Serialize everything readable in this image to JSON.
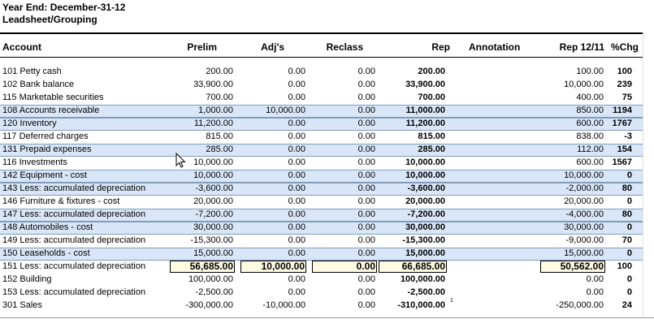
{
  "header": {
    "year_end": "Year End: December-31-12",
    "subtitle": "Leadsheet/Grouping"
  },
  "columns": {
    "account": "Account",
    "prelim": "Prelim",
    "adjs": "Adj's",
    "reclass": "Reclass",
    "rep": "Rep",
    "annotation": "Annotation",
    "rep_prior": "Rep 12/11",
    "pct_chg": "%Chg"
  },
  "rows": [
    {
      "account": "101 Petty cash",
      "prelim": "200.00",
      "adjs": "0.00",
      "reclass": "0.00",
      "rep": "200.00",
      "rep_prior": "100.00",
      "pct": "100",
      "band": false
    },
    {
      "account": "102 Bank balance",
      "prelim": "33,900.00",
      "adjs": "0.00",
      "reclass": "0.00",
      "rep": "33,900.00",
      "rep_prior": "10,000.00",
      "pct": "239",
      "band": false
    },
    {
      "account": "115 Marketable securities",
      "prelim": "700.00",
      "adjs": "0.00",
      "reclass": "0.00",
      "rep": "700.00",
      "rep_prior": "400.00",
      "pct": "75",
      "band": false
    },
    {
      "account": "108 Accounts receivable",
      "prelim": "1,000.00",
      "adjs": "10,000.00",
      "reclass": "0.00",
      "rep": "11,000.00",
      "rep_prior": "850.00",
      "pct": "1194",
      "band": true
    },
    {
      "account": "120 Inventory",
      "prelim": "11,200.00",
      "adjs": "0.00",
      "reclass": "0.00",
      "rep": "11,200.00",
      "rep_prior": "600.00",
      "pct": "1767",
      "band": true
    },
    {
      "account": "117 Deferred charges",
      "prelim": "815.00",
      "adjs": "0.00",
      "reclass": "0.00",
      "rep": "815.00",
      "rep_prior": "838.00",
      "pct": "-3",
      "band": false
    },
    {
      "account": "131 Prepaid expenses",
      "prelim": "285.00",
      "adjs": "0.00",
      "reclass": "0.00",
      "rep": "285.00",
      "rep_prior": "112.00",
      "pct": "154",
      "band": true
    },
    {
      "account": "116 Investments",
      "prelim": "10,000.00",
      "adjs": "0.00",
      "reclass": "0.00",
      "rep": "10,000.00",
      "rep_prior": "600.00",
      "pct": "1567",
      "band": false
    },
    {
      "account": "142 Equipment - cost",
      "prelim": "10,000.00",
      "adjs": "0.00",
      "reclass": "0.00",
      "rep": "10,000.00",
      "rep_prior": "10,000.00",
      "pct": "0",
      "band": true
    },
    {
      "account": "143 Less: accumulated depreciation",
      "prelim": "-3,600.00",
      "adjs": "0.00",
      "reclass": "0.00",
      "rep": "-3,600.00",
      "rep_prior": "-2,000.00",
      "pct": "80",
      "band": true
    },
    {
      "account": "146 Furniture & fixtures - cost",
      "prelim": "20,000.00",
      "adjs": "0.00",
      "reclass": "0.00",
      "rep": "20,000.00",
      "rep_prior": "20,000.00",
      "pct": "0",
      "band": false
    },
    {
      "account": "147 Less: accumulated depreciation",
      "prelim": "-7,200.00",
      "adjs": "0.00",
      "reclass": "0.00",
      "rep": "-7,200.00",
      "rep_prior": "-4,000.00",
      "pct": "80",
      "band": true
    },
    {
      "account": "148 Automobiles - cost",
      "prelim": "30,000.00",
      "adjs": "0.00",
      "reclass": "0.00",
      "rep": "30,000.00",
      "rep_prior": "30,000.00",
      "pct": "0",
      "band": true
    },
    {
      "account": "149 Less: accumulated depreciation",
      "prelim": "-15,300.00",
      "adjs": "0.00",
      "reclass": "0.00",
      "rep": "-15,300.00",
      "rep_prior": "-9,000.00",
      "pct": "70",
      "band": false
    },
    {
      "account": "150 Leaseholds - cost",
      "prelim": "15,000.00",
      "adjs": "0.00",
      "reclass": "0.00",
      "rep": "15,000.00",
      "rep_prior": "15,000.00",
      "pct": "0",
      "band": true
    },
    {
      "account": "151 Less: accumulated depreciation",
      "prelim": "56,685.00",
      "adjs": "10,000.00",
      "reclass": "0.00",
      "rep": "66,685.00",
      "rep_prior": "50,562.00",
      "pct": "100",
      "band": false,
      "total": true
    },
    {
      "account": "152 Building",
      "prelim": "100,000.00",
      "adjs": "0.00",
      "reclass": "0.00",
      "rep": "100,000.00",
      "rep_prior": "0.00",
      "pct": "0",
      "band": false
    },
    {
      "account": "153 Less:  accumulated depreciation",
      "prelim": "-2,500.00",
      "adjs": "0.00",
      "reclass": "0.00",
      "rep": "-2,500.00",
      "rep_prior": "0.00",
      "pct": "0",
      "band": false
    },
    {
      "account": "301 Sales",
      "prelim": "-300,000.00",
      "adjs": "-10,000.00",
      "reclass": "0.00",
      "rep": "-310,000.00",
      "rep_prior": "-250,000.00",
      "pct": "24",
      "band": false,
      "note": "1"
    }
  ]
}
